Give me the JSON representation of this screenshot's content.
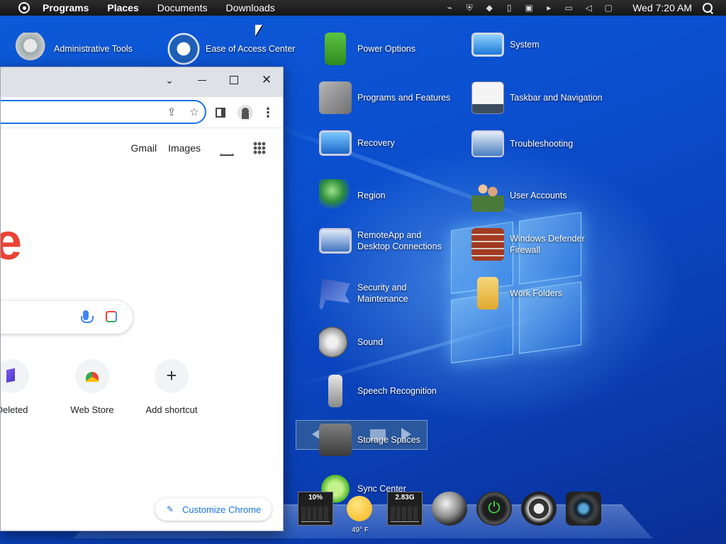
{
  "top_bar": {
    "menus": [
      "Programs",
      "Places",
      "Documents",
      "Downloads"
    ],
    "clock": "Wed 7:20 AM",
    "tray_icons": [
      "network-disconnected-icon",
      "shield-icon",
      "diamond-icon",
      "clipboard-icon",
      "screen-icon",
      "arrow-icon",
      "network-icon",
      "volume-muted-icon",
      "notification-icon",
      "search-icon"
    ]
  },
  "desktop": {
    "icons": [
      {
        "label": "Administrative Tools",
        "icon": "gear-icon"
      },
      {
        "label": "Ease of Access Center",
        "icon": "accessibility-icon"
      },
      {
        "label": "Power Options",
        "icon": "battery-icon"
      },
      {
        "label": "System",
        "icon": "monitor-icon"
      },
      {
        "label": "Programs and Features",
        "icon": "programs-icon"
      },
      {
        "label": "Taskbar and Navigation",
        "icon": "taskbar-icon"
      },
      {
        "label": "Recovery",
        "icon": "recovery-icon"
      },
      {
        "label": "Troubleshooting",
        "icon": "troubleshoot-icon"
      },
      {
        "label": "Region",
        "icon": "globe-clock-icon"
      },
      {
        "label": "User Accounts",
        "icon": "users-icon"
      },
      {
        "label": "RemoteApp and Desktop Connections",
        "icon": "remote-desktop-icon"
      },
      {
        "label": "Windows Defender Firewall",
        "icon": "firewall-icon"
      },
      {
        "label": "Security and Maintenance",
        "icon": "flag-icon"
      },
      {
        "label": "Work Folders",
        "icon": "folder-icon"
      },
      {
        "label": "Sound",
        "icon": "speaker-icon"
      },
      {
        "label": "Speech Recognition",
        "icon": "microphone-icon"
      },
      {
        "label": "Storage Spaces",
        "icon": "storage-icon"
      },
      {
        "label": "Sync Center",
        "icon": "sync-icon"
      }
    ]
  },
  "dock": {
    "cpu_meter": "10%",
    "weather_temp": "49° F",
    "memory_meter": "2.83G",
    "items": [
      "cpu-meter-icon",
      "weather-icon",
      "memory-meter-icon",
      "globe-icon",
      "power-icon",
      "headphones-icon",
      "camera-icon"
    ]
  },
  "chrome": {
    "links": {
      "gmail": "Gmail",
      "images": "Images"
    },
    "logo_fragment": "e",
    "shortcuts": [
      {
        "label": "Deleted"
      },
      {
        "label": "Web Store"
      },
      {
        "label": "Add shortcut"
      }
    ],
    "customize_label": "Customize Chrome",
    "close_glyph": "✕",
    "tabsearch_glyph": "⌄"
  }
}
